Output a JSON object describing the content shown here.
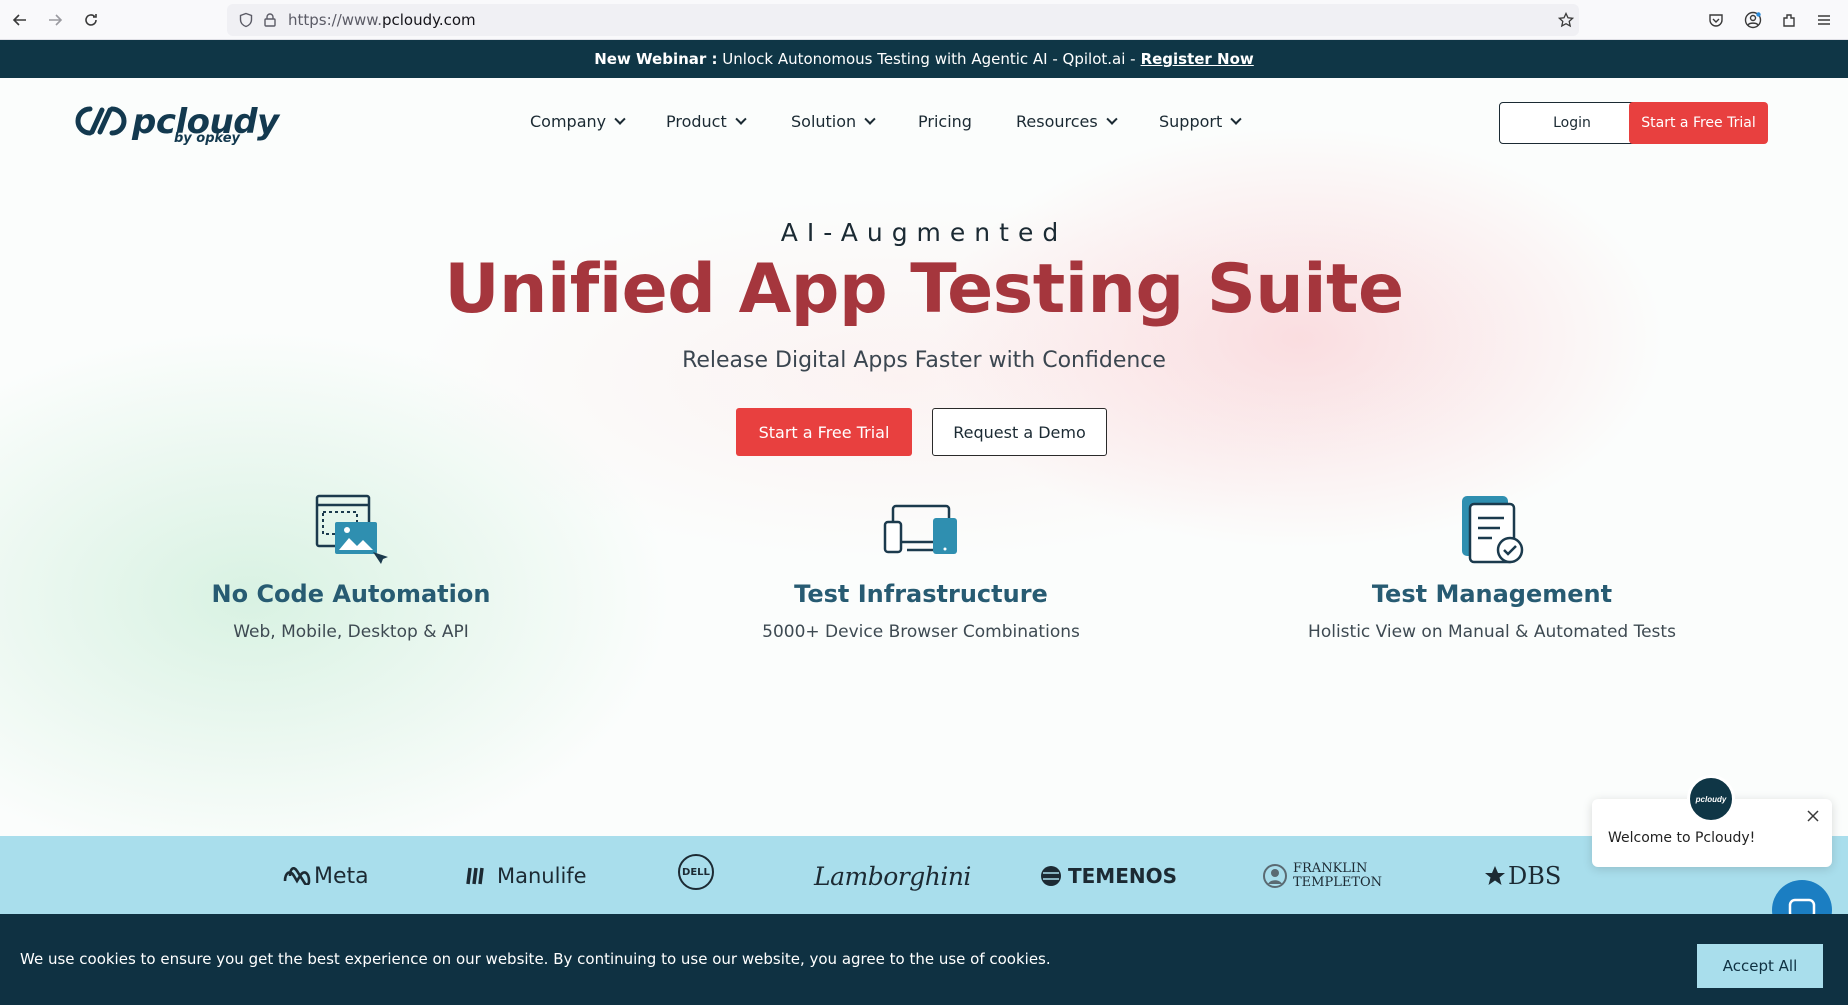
{
  "browser": {
    "url_prefix": "https://www.",
    "url_domain": "pcloudy.com",
    "icons": [
      "back-icon",
      "forward-icon",
      "reload-icon",
      "shield-icon",
      "lock-icon",
      "star-icon",
      "pocket-icon",
      "account-icon",
      "extensions-icon",
      "menu-icon"
    ]
  },
  "banner": {
    "lead": "New Webinar :",
    "text": "Unlock Autonomous Testing with Agentic AI - Qpilot.ai -",
    "link": "Register Now"
  },
  "header": {
    "logo_name": "pcloudy",
    "logo_sub": "by opkey",
    "nav": [
      {
        "label": "Company",
        "dropdown": true
      },
      {
        "label": "Product",
        "dropdown": true
      },
      {
        "label": "Solution",
        "dropdown": true
      },
      {
        "label": "Pricing",
        "dropdown": false
      },
      {
        "label": "Resources",
        "dropdown": true
      },
      {
        "label": "Support",
        "dropdown": true
      }
    ],
    "login": "Login",
    "trial": "Start a Free Trial"
  },
  "hero": {
    "eyebrow": "AI-Augmented",
    "title": "Unified App Testing Suite",
    "subtitle": "Release Digital Apps Faster with Confidence",
    "cta_primary": "Start a Free Trial",
    "cta_secondary": "Request a Demo"
  },
  "features": [
    {
      "title": "No Code Automation",
      "desc": "Web, Mobile, Desktop & API",
      "icon": "no-code-automation-icon"
    },
    {
      "title": "Test Infrastructure",
      "desc": "5000+ Device Browser Combinations",
      "icon": "devices-icon"
    },
    {
      "title": "Test Management",
      "desc": "Holistic View on Manual & Automated Tests",
      "icon": "test-management-icon"
    }
  ],
  "clients": [
    "Meta",
    "Manulife",
    "DELL",
    "Lamborghini",
    "TEMENOS",
    "FRANKLIN",
    "TEMPLETON",
    "DBS"
  ],
  "chat": {
    "avatar_text": "pcloudy",
    "message": "Welcome to Pcloudy!"
  },
  "cookie": {
    "text": "We use cookies to ensure you get the best experience on our website. By continuing to use our website, you agree to the use of cookies.",
    "accept": "Accept All"
  },
  "colors": {
    "accent_red": "#e8403f",
    "title_red": "#a5363d",
    "navy": "#0f3646",
    "teal": "#275b72",
    "logo_strip": "#a9deec"
  }
}
